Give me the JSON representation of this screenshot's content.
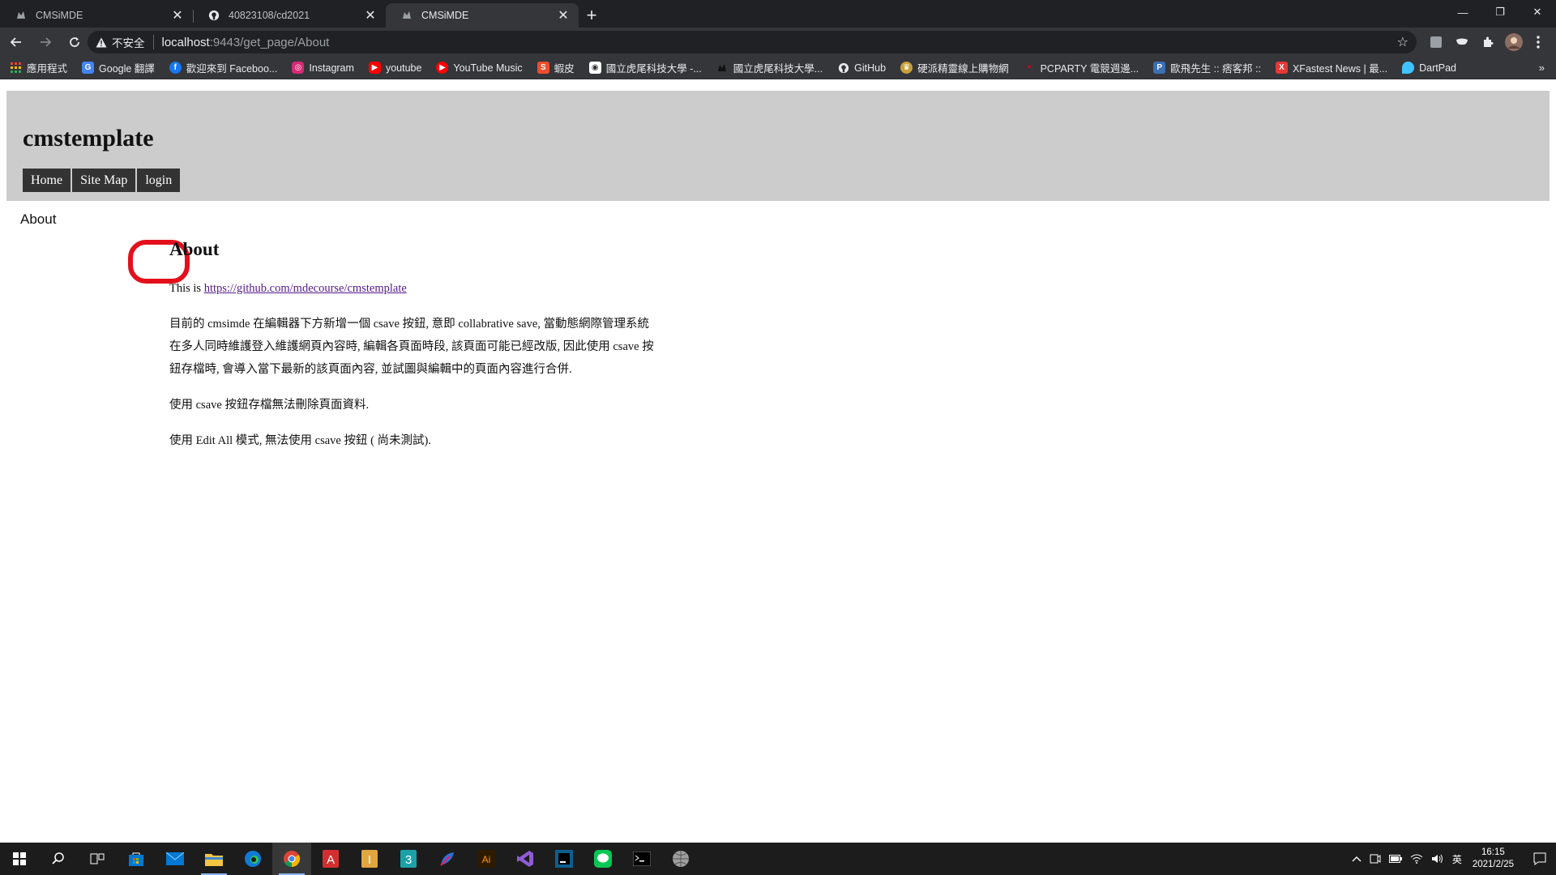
{
  "browser": {
    "tabs": [
      {
        "title": "CMSiMDE",
        "icon": "cms-favicon-icon",
        "active": false
      },
      {
        "title": "40823108/cd2021",
        "icon": "github-icon",
        "active": false
      },
      {
        "title": "CMSiMDE",
        "icon": "cms-favicon-icon",
        "active": true
      }
    ],
    "new_tab_label": "+",
    "address_bar": {
      "security_label": "不安全",
      "url_host": "localhost",
      "url_rest": ":9443/get_page/About"
    },
    "bookmarks": [
      {
        "label": "應用程式",
        "icon": "apps-grid-icon",
        "color": "#4285f4"
      },
      {
        "label": "Google 翻譯",
        "icon": "google-translate-icon",
        "color": "#4285f4"
      },
      {
        "label": "歡迎來到 Faceboo...",
        "icon": "facebook-icon",
        "color": "#1877f2"
      },
      {
        "label": "Instagram",
        "icon": "instagram-icon",
        "color": "#d62976"
      },
      {
        "label": "youtube",
        "icon": "youtube-icon",
        "color": "#ff0000"
      },
      {
        "label": "YouTube Music",
        "icon": "youtube-music-icon",
        "color": "#ff0000"
      },
      {
        "label": "蝦皮",
        "icon": "shopee-icon",
        "color": "#ee4d2d"
      },
      {
        "label": "國立虎尾科技大學 -...",
        "icon": "nfu-icon",
        "color": "#ffffff"
      },
      {
        "label": "國立虎尾科技大學...",
        "icon": "cms-favicon-icon",
        "color": "#111111"
      },
      {
        "label": "GitHub",
        "icon": "github-icon",
        "color": "#ffffff"
      },
      {
        "label": "硬派精靈線上購物網",
        "icon": "coolpc-icon",
        "color": "#c8a03a"
      },
      {
        "label": "PCPARTY 電競週邊...",
        "icon": "pcparty-icon",
        "color": "#d0021b"
      },
      {
        "label": "歐飛先生 :: 痞客邦 ::",
        "icon": "pixnet-icon",
        "color": "#3b6fb6"
      },
      {
        "label": "XFastest News | 最...",
        "icon": "xfastest-icon",
        "color": "#e53935"
      },
      {
        "label": "DartPad",
        "icon": "dartpad-icon",
        "color": "#40c4ff"
      }
    ],
    "bookmarks_more": "»"
  },
  "site": {
    "title": "cmstemplate",
    "nav": [
      "Home",
      "Site Map",
      "login"
    ],
    "breadcrumb": "About",
    "heading": "About",
    "intro_prefix": "This is ",
    "intro_link": "https://github.com/mdecourse/cmstemplate",
    "paragraphs": [
      "目前的 cmsimde 在編輯器下方新增一個 csave 按鈕, 意即 collabrative save, 當動態網際管理系統在多人同時維護登入維護網頁內容時, 編輯各頁面時段, 該頁面可能已經改版, 因此使用 csave 按鈕存檔時, 會導入當下最新的該頁面內容, 並試圖與編輯中的頁面內容進行合併.",
      "使用 csave 按鈕存檔無法刪除頁面資料.",
      "使用 Edit All 模式, 無法使用 csave 按鈕 ( 尚未測試)."
    ]
  },
  "taskbar": {
    "apps": [
      "windows-start-icon",
      "search-icon",
      "task-view-icon",
      "store-icon",
      "mail-icon",
      "file-explorer-icon",
      "edge-icon",
      "chrome-icon",
      "acrobat-icon",
      "inventor-icon",
      "app-3-icon",
      "feather-app-icon",
      "illustrator-icon",
      "visual-studio-icon",
      "intellij-icon",
      "line-icon",
      "terminal-icon",
      "globe-app-icon"
    ],
    "tray_lang": "英",
    "time": "16:15",
    "date": "2021/2/25"
  },
  "colors": {
    "tab_bg": "#202124",
    "toolbar_bg": "#35363a",
    "header_bg": "#cccccc",
    "nav_bg": "#333333",
    "highlight": "#e3101c",
    "link": "#551a8b"
  }
}
